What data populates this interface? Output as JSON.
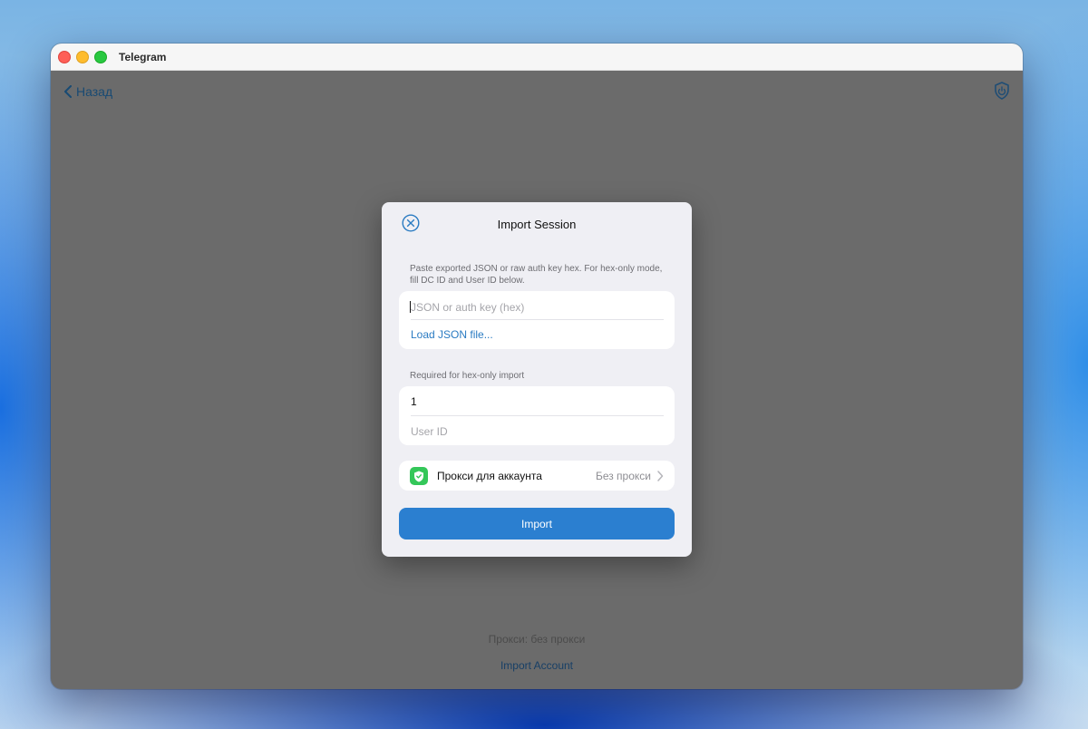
{
  "window": {
    "title": "Telegram"
  },
  "nav": {
    "back_label": "Назад"
  },
  "footer": {
    "proxy_status": "Прокси: без прокси",
    "import_account_label": "Import Account"
  },
  "modal": {
    "title": "Import Session",
    "hint": "Paste exported JSON or raw auth key hex. For hex-only mode, fill DC ID and User ID below.",
    "json_input": {
      "value": "",
      "placeholder": "JSON or auth key (hex)"
    },
    "load_json_label": "Load JSON file...",
    "section_label": "Required for hex-only import",
    "dc_id": {
      "value": "1"
    },
    "user_id": {
      "value": "",
      "placeholder": "User ID"
    },
    "proxy": {
      "label": "Прокси для аккаунта",
      "value": "Без прокси"
    },
    "import_label": "Import"
  },
  "colors": {
    "accent": "#2b7fd0",
    "proxy_icon_bg": "#34c759",
    "overlay": "#6b6b6b"
  },
  "icons": {
    "back": "chevron-left-icon",
    "shield": "shield-icon",
    "close": "close-circle-icon",
    "chevron": "chevron-right-icon"
  }
}
